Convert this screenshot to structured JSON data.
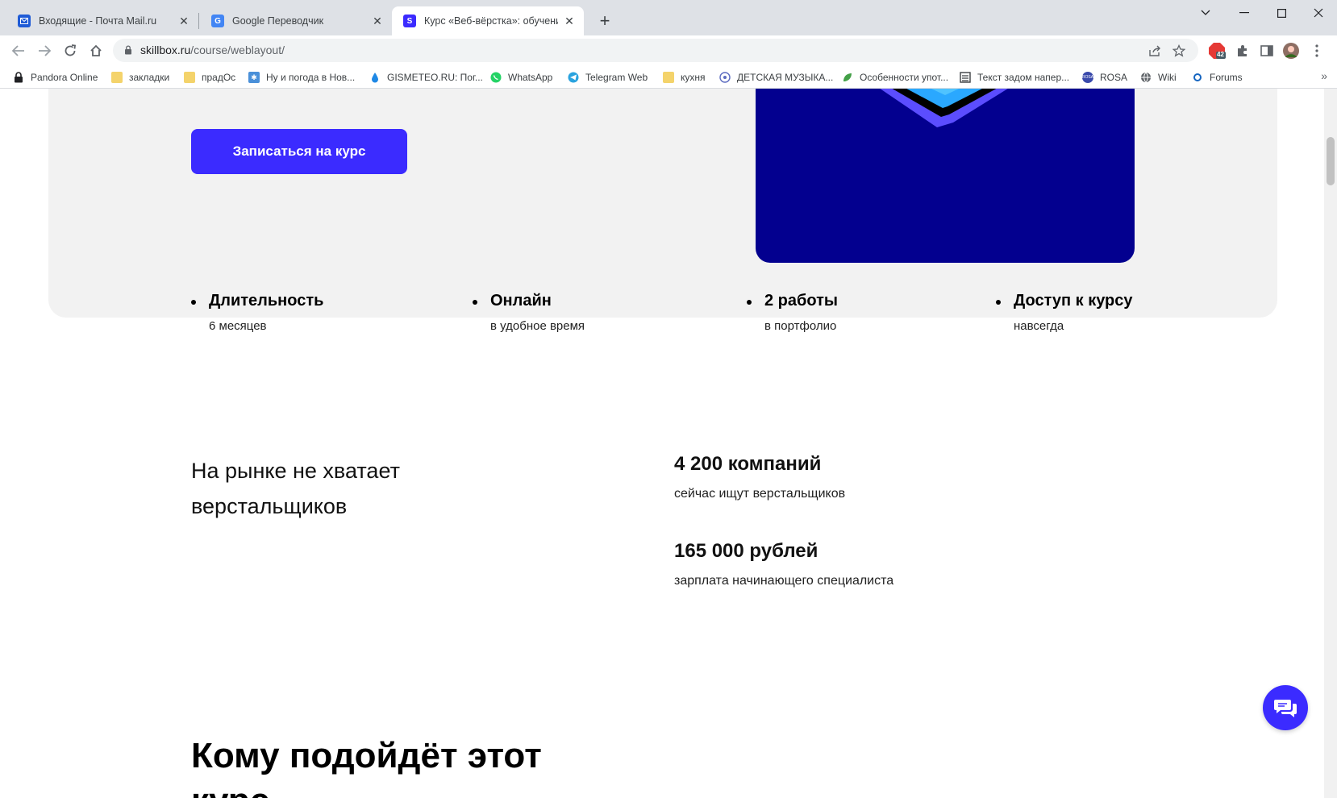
{
  "tabs": [
    {
      "title": "Входящие - Почта Mail.ru",
      "icon": "mail-icon"
    },
    {
      "title": "Google Переводчик",
      "icon": "translate-icon"
    },
    {
      "title": "Курс «Веб-вёрстка»: обучение",
      "icon": "skillbox-icon",
      "favicon_letter": "S"
    }
  ],
  "address_bar": {
    "domain": "skillbox.ru",
    "path": "/course/weblayout/"
  },
  "extension_badge": "42",
  "bookmarks": [
    {
      "label": "Pandora Online",
      "icon": "lock-icon"
    },
    {
      "label": "закладки",
      "icon": "folder-icon"
    },
    {
      "label": "прадОс",
      "icon": "folder-icon"
    },
    {
      "label": "Ну и погода в Нов...",
      "icon": "weather-icon"
    },
    {
      "label": "GISMETEO.RU: Пог...",
      "icon": "drop-icon"
    },
    {
      "label": "WhatsApp",
      "icon": "whatsapp-icon"
    },
    {
      "label": "Telegram Web",
      "icon": "telegram-icon"
    },
    {
      "label": "кухня",
      "icon": "folder-icon"
    },
    {
      "label": "ДЕТСКАЯ МУЗЫКА...",
      "icon": "music-icon"
    },
    {
      "label": "Особенности упот...",
      "icon": "leaf-icon"
    },
    {
      "label": "Текст задом напер...",
      "icon": "document-icon"
    },
    {
      "label": "ROSA",
      "icon": "rosa-icon"
    },
    {
      "label": "Wiki",
      "icon": "globe-icon"
    },
    {
      "label": "Forums",
      "icon": "forum-icon"
    }
  ],
  "page": {
    "enroll_button": "Записаться на курс",
    "facts": [
      {
        "title": "Длительность",
        "sub": "6 месяцев"
      },
      {
        "title": "Онлайн",
        "sub": "в удобное время"
      },
      {
        "title": "2 работы",
        "sub": "в портфолио"
      },
      {
        "title": "Доступ к курсу",
        "sub": "навсегда"
      }
    ],
    "market_heading_line1": "На рынке не хватает",
    "market_heading_line2": "верстальщиков",
    "stats": [
      {
        "value": "4 200 компаний",
        "caption": "сейчас ищут верстальщиков"
      },
      {
        "value": "165 000 рублей",
        "caption": "зарплата начинающего специалиста"
      }
    ],
    "who_heading": "Кому подойдёт этот курс"
  },
  "colors": {
    "accent": "#3b2bff",
    "hero_bg": "#f2f2f2",
    "art_bg": "#03008f"
  }
}
